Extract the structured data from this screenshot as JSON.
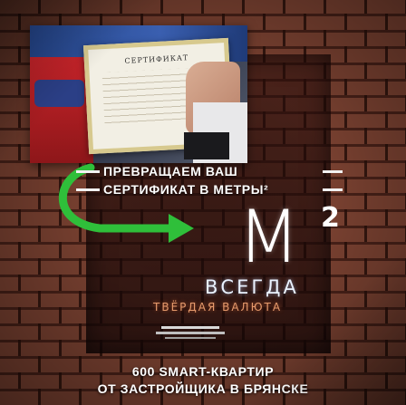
{
  "headline": {
    "line1": "ПРЕВРАЩАЕМ ВАШ",
    "line2": "СЕРТИФИКАТ В МЕТРЫ²"
  },
  "unit": {
    "main": "M",
    "superscript": "2"
  },
  "slogan": {
    "line1": "ВСЕГДА",
    "line2": "ТВЁРДАЯ ВАЛЮТА"
  },
  "photo": {
    "certificate_label": "СЕРТИФИКАТ"
  },
  "footer": {
    "line1": "600 SMART-КВАРТИР",
    "line2": "ОТ ЗАСТРОЙЩИКА В БРЯНСКЕ"
  },
  "colors": {
    "arrow": "#2fbf3a",
    "brick": "#7f4433",
    "valuta": "#e59a6c"
  },
  "icons": [
    "arrow-icon",
    "logo-icon"
  ]
}
